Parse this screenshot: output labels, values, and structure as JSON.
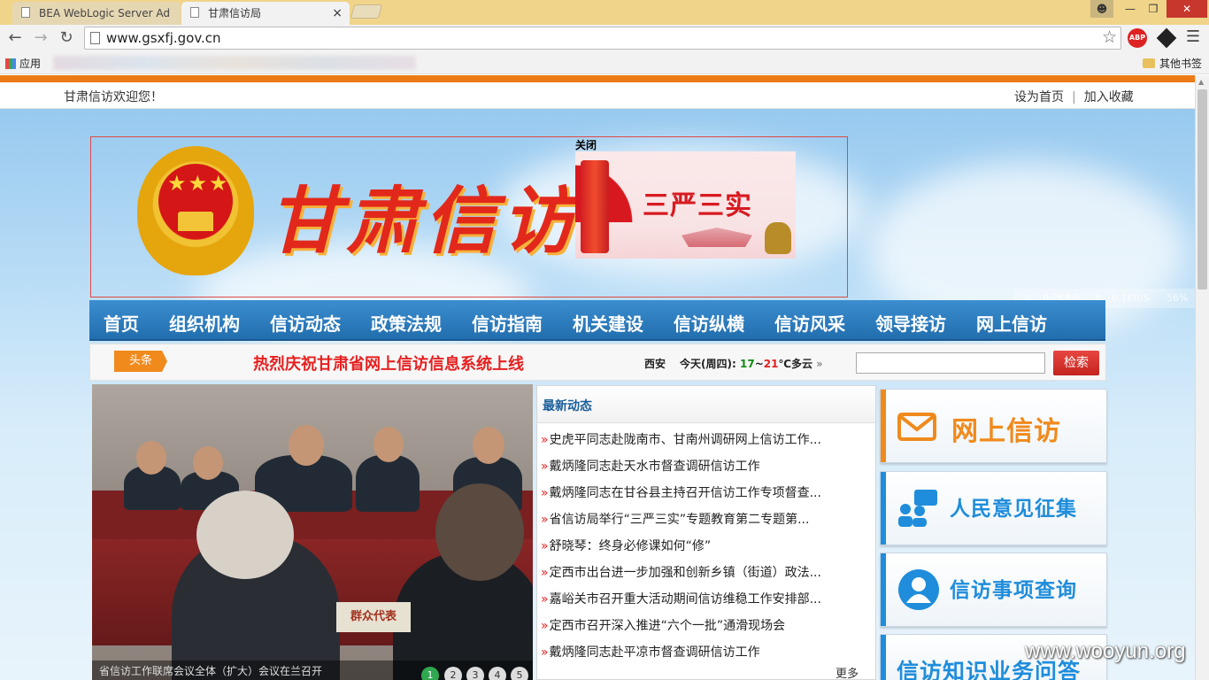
{
  "browser": {
    "tabs": [
      {
        "title": "BEA WebLogic Server Ad"
      },
      {
        "title": "甘肃信访局"
      }
    ],
    "close_glyph": "×",
    "url": "www.gsxfj.gov.cn",
    "apps_label": "应用",
    "other_bookmarks": "其他书签",
    "abp_label": "ABP",
    "icons": [
      "back-icon",
      "forward-icon",
      "reload-icon",
      "page-icon",
      "star-icon",
      "menu-icon"
    ]
  },
  "site": {
    "welcome": "甘肃信访欢迎您！",
    "set_home": "设为首页",
    "add_fav": "加入收藏",
    "divider": "|",
    "banner_title": "甘肃信访",
    "ad": {
      "close": "关闭",
      "text": "三严三实"
    },
    "net_speed": {
      "down": "0.2KB/S",
      "up": "0.1KB/S",
      "percent": "56%"
    },
    "nav": [
      "首页",
      "组织机构",
      "信访动态",
      "政策法规",
      "信访指南",
      "机关建设",
      "信访纵横",
      "信访风采",
      "领导接访",
      "网上信访"
    ],
    "headline_badge": "头条",
    "headline": "热烈庆祝甘肃省网上信访信息系统上线",
    "weather": {
      "city": "西安",
      "label": "今天(周四):",
      "low": "17",
      "sep": "~",
      "high": "21",
      "desc": "℃多云",
      "arrow": "»"
    },
    "search_button": "检索",
    "photo": {
      "nameplate": "群众代表",
      "caption": "省信访工作联席会议全体（扩大）会议在兰召开",
      "pages": [
        "1",
        "2",
        "3",
        "4",
        "5"
      ]
    },
    "latest": {
      "title": "最新动态",
      "bullet": "»",
      "items": [
        "史虎平同志赴陇南市、甘南州调研网上信访工作...",
        "戴炳隆同志赴天水市督查调研信访工作",
        "戴炳隆同志在甘谷县主持召开信访工作专项督查...",
        "省信访局举行“三严三实”专题教育第二专题第...",
        "舒晓琴：终身必修课如何“修”",
        "定西市出台进一步加强和创新乡镇（街道）政法...",
        "嘉峪关市召开重大活动期间信访维稳工作安排部...",
        "定西市召开深入推进“六个一批”通滑现场会",
        "戴炳隆同志赴平凉市督查调研信访工作"
      ],
      "more": "更多"
    },
    "side_buttons": [
      "网上信访",
      "人民意见征集",
      "信访事项查询",
      "信访知识业务问答"
    ],
    "accent_colors": {
      "orange": "#ec7b16",
      "nav_blue": "#226eae",
      "red": "#e62020",
      "green": "#2fa84f"
    }
  },
  "watermark": "www.wooyun.org"
}
